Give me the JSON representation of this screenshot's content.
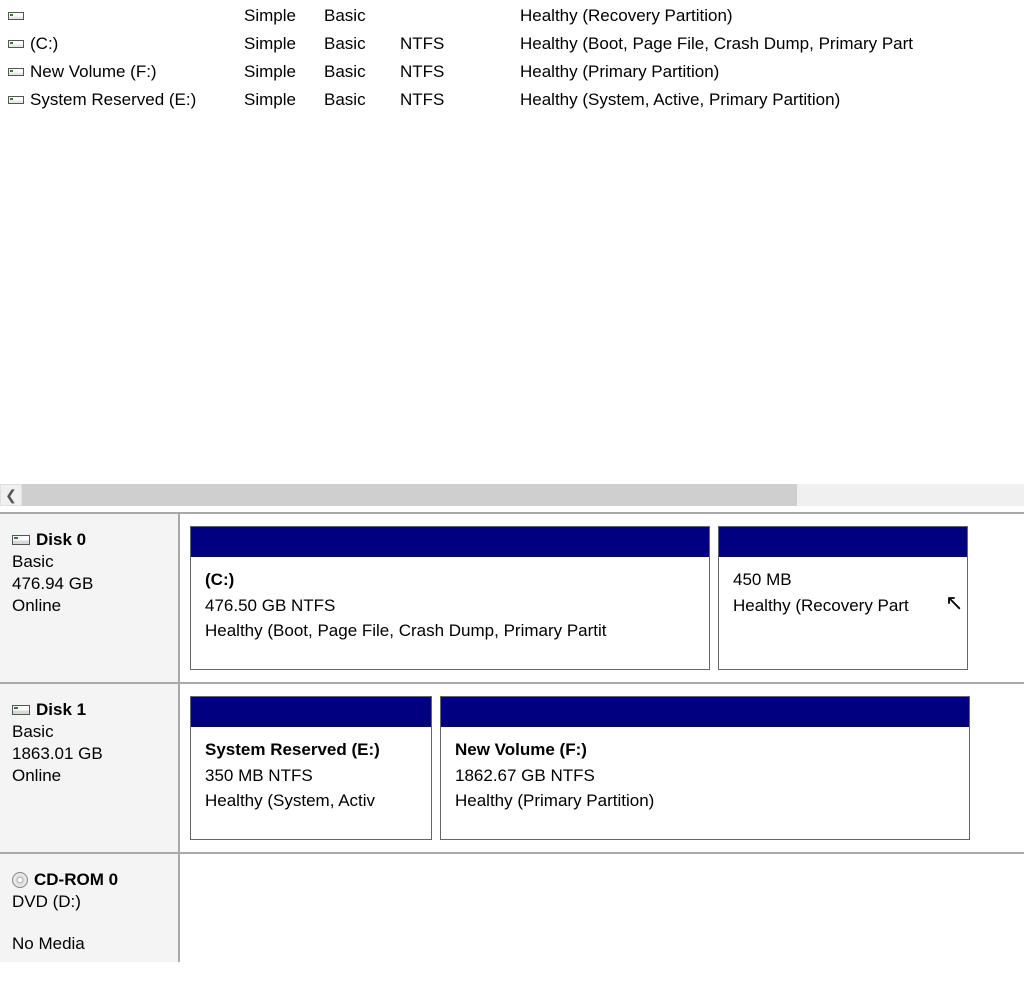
{
  "volumes": [
    {
      "name": "",
      "layout": "Simple",
      "type": "Basic",
      "fs": "",
      "status": "Healthy (Recovery Partition)"
    },
    {
      "name": "(C:)",
      "layout": "Simple",
      "type": "Basic",
      "fs": "NTFS",
      "status": "Healthy (Boot, Page File, Crash Dump, Primary Part"
    },
    {
      "name": "New Volume (F:)",
      "layout": "Simple",
      "type": "Basic",
      "fs": "NTFS",
      "status": "Healthy (Primary Partition)"
    },
    {
      "name": "System Reserved (E:)",
      "layout": "Simple",
      "type": "Basic",
      "fs": "NTFS",
      "status": "Healthy (System, Active, Primary Partition)"
    }
  ],
  "disks": [
    {
      "title": "Disk 0",
      "kind": "Basic",
      "size": "476.94 GB",
      "state": "Online",
      "icon": "disk",
      "partitions": [
        {
          "name": "(C:)",
          "info": "476.50 GB NTFS",
          "status": "Healthy (Boot, Page File, Crash Dump, Primary Partit"
        },
        {
          "name": "",
          "info": "450 MB",
          "status": "Healthy (Recovery Part"
        }
      ]
    },
    {
      "title": "Disk 1",
      "kind": "Basic",
      "size": "1863.01 GB",
      "state": "Online",
      "icon": "disk",
      "partitions": [
        {
          "name": "System Reserved  (E:)",
          "info": "350 MB NTFS",
          "status": "Healthy (System, Activ"
        },
        {
          "name": "New Volume  (F:)",
          "info": "1862.67 GB NTFS",
          "status": "Healthy (Primary Partition)"
        }
      ]
    },
    {
      "title": "CD-ROM 0",
      "kind": "DVD (D:)",
      "size": "",
      "state": "No Media",
      "icon": "cd",
      "partitions": []
    }
  ]
}
